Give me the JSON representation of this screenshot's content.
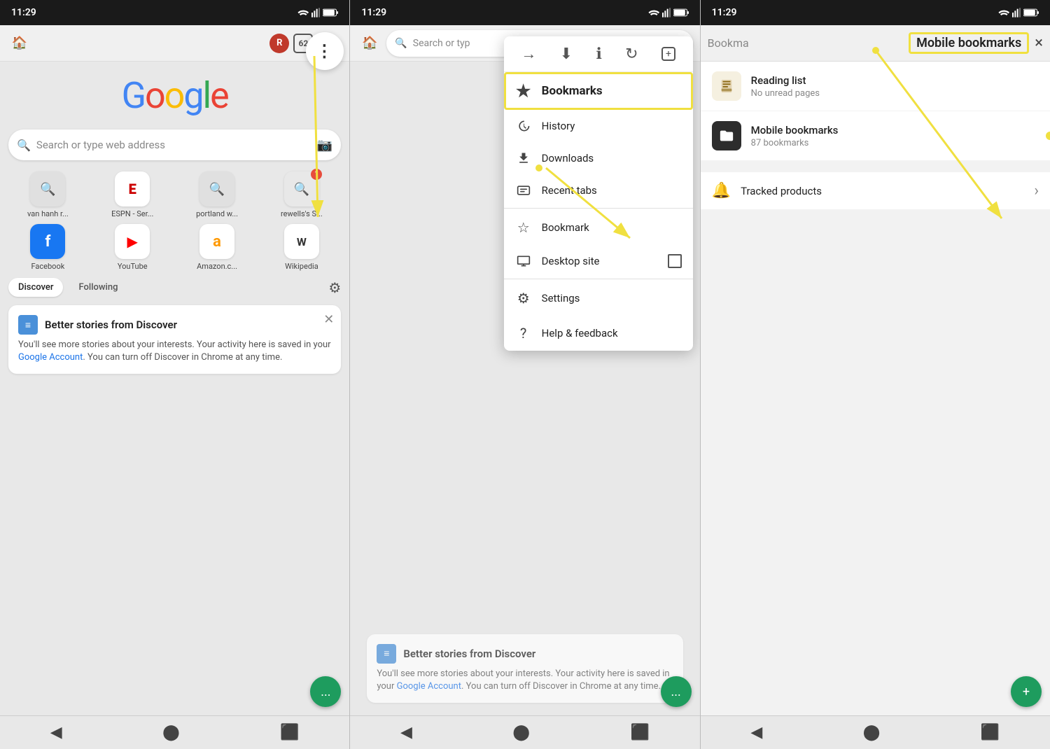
{
  "status": {
    "time": "11:29"
  },
  "panel1": {
    "avatar_initial": "R",
    "tab_count": "62",
    "search_placeholder": "Search or type web address",
    "shortcuts": [
      {
        "label": "van hanh r...",
        "type": "search"
      },
      {
        "label": "ESPN - Ser...",
        "type": "espn"
      },
      {
        "label": "portland w...",
        "type": "search"
      },
      {
        "label": "rewells's S...",
        "type": "badge1"
      },
      {
        "label": "Facebook",
        "type": "facebook"
      },
      {
        "label": "YouTube",
        "type": "youtube"
      },
      {
        "label": "Amazon.c...",
        "type": "amazon"
      },
      {
        "label": "Wikipedia",
        "type": "wikipedia"
      }
    ],
    "discover_tab": "Discover",
    "following_tab": "Following",
    "card_title": "Better stories from Discover",
    "card_body1": "You'll see more stories about your interests. Your activity here is saved in your ",
    "card_link": "Google Account",
    "card_body2": ". You can turn off Discover in Chrome at any time."
  },
  "panel2": {
    "menu_items": [
      {
        "label": "History",
        "icon": "history"
      },
      {
        "label": "Downloads",
        "icon": "downloads"
      },
      {
        "label": "Bookmarks",
        "icon": "bookmarks"
      },
      {
        "label": "Recent tabs",
        "icon": "recent"
      },
      {
        "label": "Bookmark",
        "icon": "bookmark"
      },
      {
        "label": "Desktop site",
        "icon": "desktop"
      },
      {
        "label": "Settings",
        "icon": "settings"
      },
      {
        "label": "Help & feedback",
        "icon": "help"
      }
    ],
    "search_placeholder": "Search or typ"
  },
  "panel3": {
    "title": "Bookma",
    "mobile_bookmarks_title": "Mobile bookmarks",
    "close_icon": "×",
    "reading_list_name": "Reading list",
    "reading_list_sub": "No unread pages",
    "mobile_bookmarks_name": "Mobile bookmarks",
    "mobile_bookmarks_sub": "87 bookmarks",
    "tracked_label": "Tracked products",
    "tracked_chevron": "›"
  }
}
